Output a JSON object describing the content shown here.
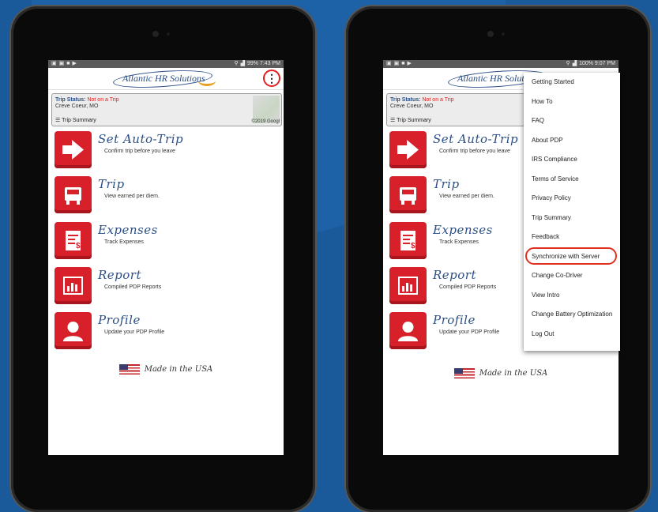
{
  "colors": {
    "background": "#1a5a9a",
    "accent_red": "#d8202a",
    "brand_blue": "#2b4f86",
    "highlight_red": "#e02020"
  },
  "left_tablet": {
    "status_time": "99% 7:43 PM",
    "logo_text": "Atlantic HR Solutions",
    "menu_button": "⋮",
    "trip_status_label": "Trip Status:",
    "trip_status_value": "Not on a Trip",
    "location": "Creve Coeur, MO",
    "trip_summary_link": "Trip Summary",
    "map_caption": "©2019 Googl"
  },
  "right_tablet": {
    "status_time": "100% 9:07 PM",
    "logo_text": "Atlantic HR Solution"
  },
  "menu_rows": [
    {
      "title": "Set Auto-Trip",
      "subtitle": "Confirm trip before you leave",
      "icon": "arrow-right-icon"
    },
    {
      "title": "Trip",
      "subtitle": "View earned per diem.",
      "icon": "truck-icon"
    },
    {
      "title": "Expenses",
      "subtitle": "Track Expenses",
      "icon": "receipt-icon"
    },
    {
      "title": "Report",
      "subtitle": "Compiled PDP Reports",
      "icon": "bar-chart-icon"
    },
    {
      "title": "Profile",
      "subtitle": "Update your PDP Profile",
      "icon": "user-icon"
    }
  ],
  "footer": "Made in the USA",
  "dropdown_items": [
    "Getting Started",
    "How To",
    "FAQ",
    "About PDP",
    "IRS Compliance",
    "Terms of Service",
    "Privacy Policy",
    "Trip Summary",
    "Feedback",
    "Synchronize with Server",
    "Change Co-Driver",
    "View Intro",
    "Change Battery Optimization",
    "Log Out"
  ],
  "highlighted_item": "Synchronize with Server"
}
